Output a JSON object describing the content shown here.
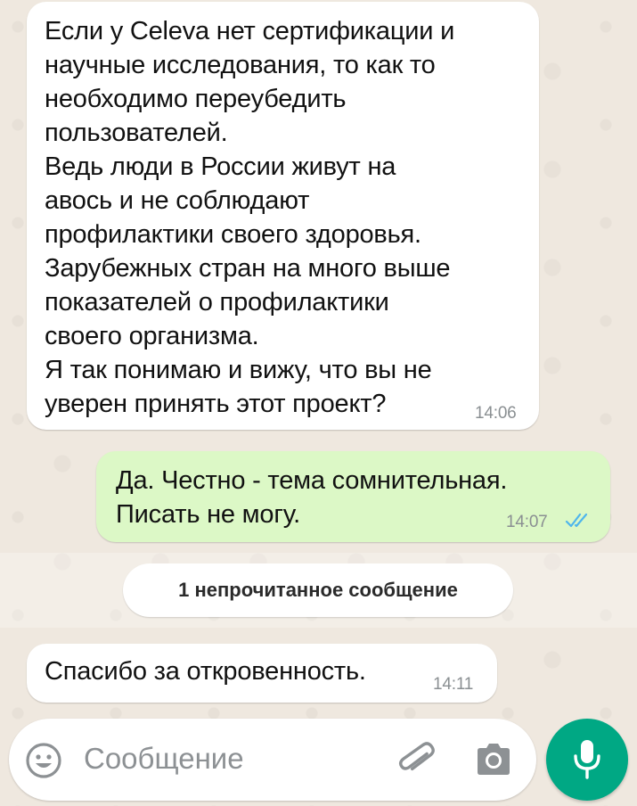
{
  "messages": [
    {
      "direction": "incoming",
      "text": "Если у Celeva нет сертификации и\nнаучные исследования, то как то\nнеобходимо переубедить\nпользователей.\nВедь люди в России живут на\nавось и не соблюдают\nпрофилактики своего здоровья.\nЗарубежных стран на много выше\nпоказателей о профилактики\nсвоего организма.\nЯ так понимаю и вижу, что вы не\nуверен принять этот проект?",
      "time": "14:06"
    },
    {
      "direction": "outgoing",
      "text": "Да. Честно - тема сомнительная.\nПисать не могу.",
      "time": "14:07",
      "status": "read-double-check-icon"
    },
    {
      "direction": "incoming",
      "text": "Спасибо за откровенность.",
      "time": "14:11"
    }
  ],
  "unread_divider": {
    "label": "1 непрочитанное сообщение"
  },
  "composer": {
    "placeholder": "Сообщение",
    "emoji_icon": "emoji-icon",
    "attach_icon": "paperclip-icon",
    "camera_icon": "camera-icon",
    "mic_icon": "microphone-icon"
  },
  "colors": {
    "incoming_bubble": "#ffffff",
    "outgoing_bubble": "#dcf8c6",
    "accent": "#00a884",
    "read_ticks": "#4fb6ec",
    "background": "#efe8df"
  }
}
